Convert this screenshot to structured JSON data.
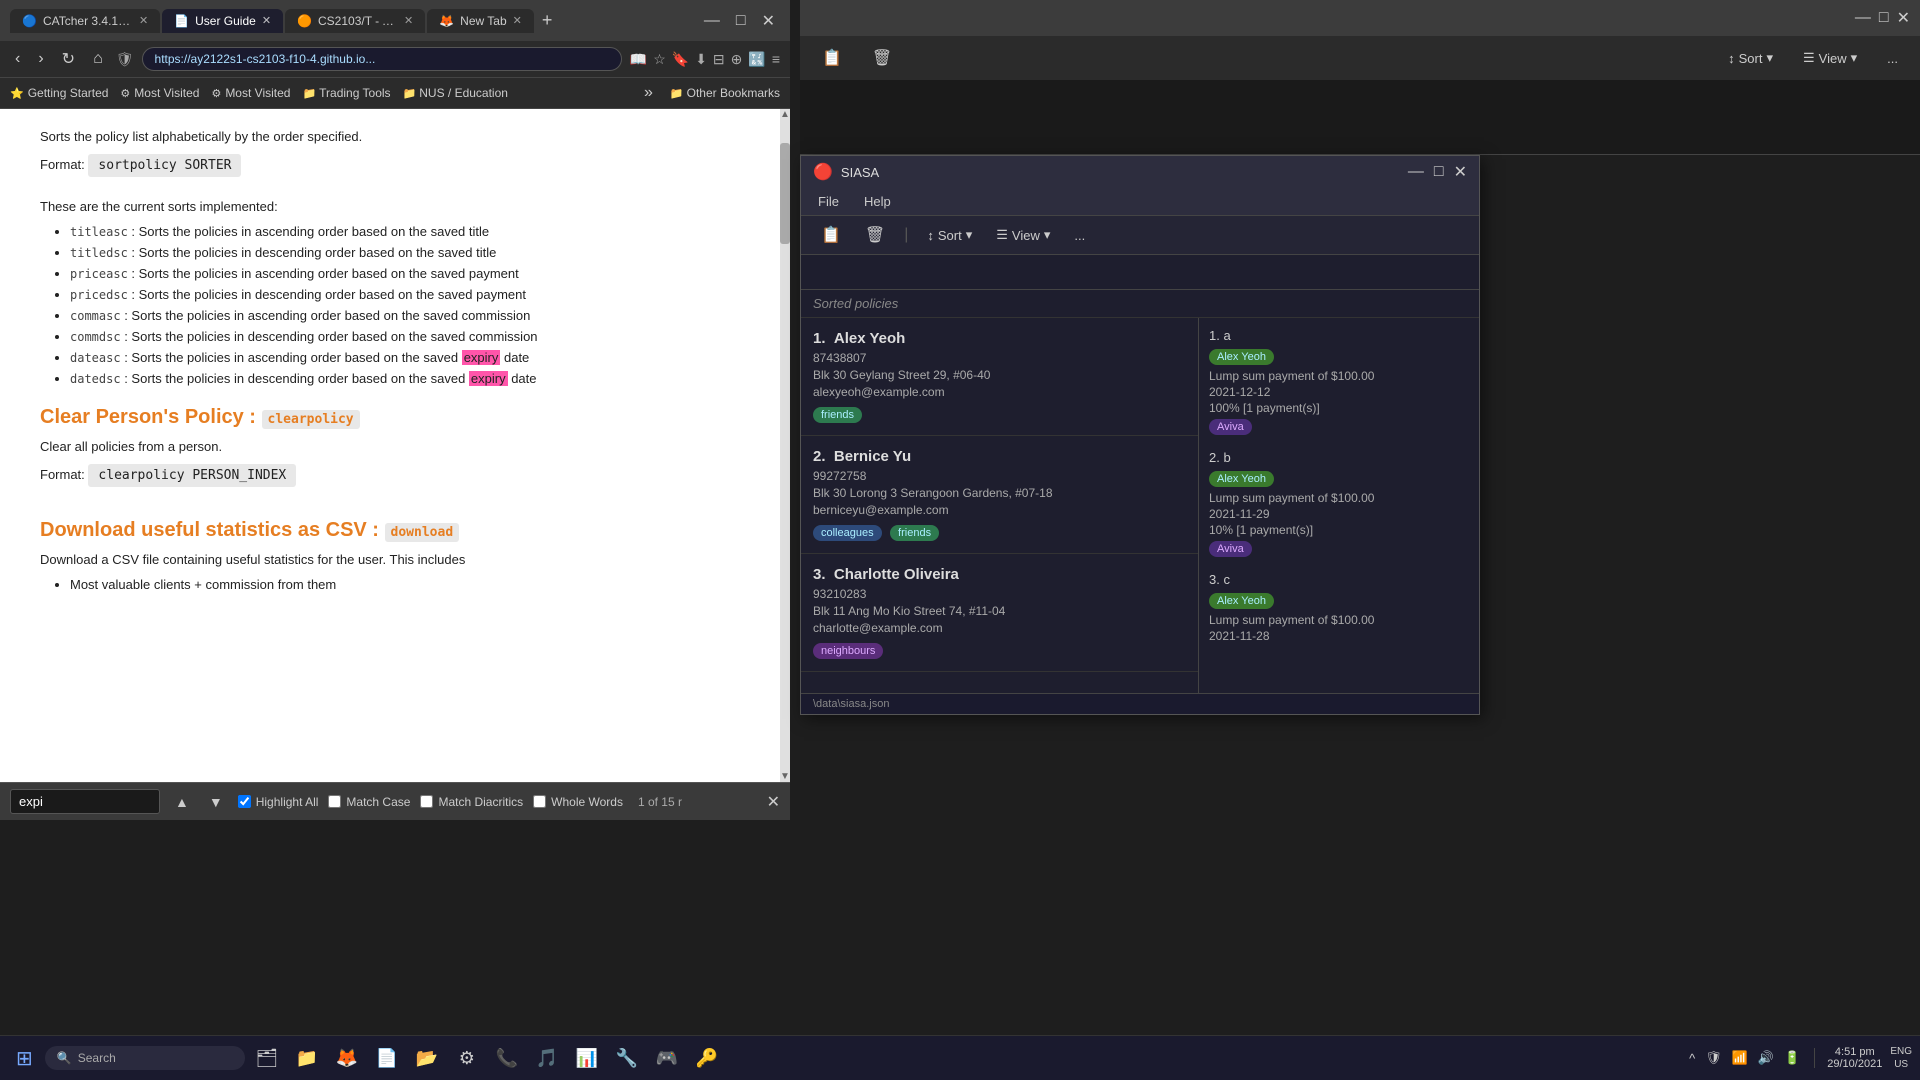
{
  "browser": {
    "tabs": [
      {
        "id": "tab1",
        "label": "CATcher 3.4.1 - ...",
        "icon": "🔵",
        "active": false
      },
      {
        "id": "tab2",
        "label": "User Guide",
        "icon": "📄",
        "active": true
      },
      {
        "id": "tab3",
        "label": "CS2103/T - Adr...",
        "icon": "🟠",
        "active": false
      },
      {
        "id": "tab4",
        "label": "New Tab",
        "icon": "🦊",
        "active": false
      }
    ],
    "address": "https://ay2122s1-cs2103-f10-4.github.io...",
    "bookmarks": [
      {
        "label": "Getting Started",
        "icon": "⭐"
      },
      {
        "label": "Most Visited",
        "icon": "⚙"
      },
      {
        "label": "Most Visited",
        "icon": "⚙"
      },
      {
        "label": "Trading Tools",
        "icon": "📁"
      },
      {
        "label": "NUS / Education",
        "icon": "📁"
      }
    ],
    "other_bookmarks": "Other Bookmarks"
  },
  "page": {
    "format_label": "Format:",
    "format_code1": "sortpolicy SORTER",
    "current_sorts_text": "These are the current sorts implemented:",
    "sorts": [
      {
        "code": "titleasc",
        "desc": ": Sorts the policies in ascending order based on the saved title"
      },
      {
        "code": "titledsc",
        "desc": ": Sorts the policies in descending order based on the saved title"
      },
      {
        "code": "priceasc",
        "desc": ": Sorts the policies in ascending order based on the saved payment"
      },
      {
        "code": "pricedsc",
        "desc": ": Sorts the policies in descending order based on the saved payment"
      },
      {
        "code": "commasc",
        "desc": ": Sorts the policies in ascending order based on the saved commission"
      },
      {
        "code": "commdsc",
        "desc": ": Sorts the policies in descending order based on the saved commission"
      },
      {
        "code": "dateasc",
        "desc": ": Sorts the policies in ascending order based on the saved expiry date"
      },
      {
        "code": "datedsc",
        "desc": ": Sorts the policies in descending order based on the saved expiry date"
      }
    ],
    "section2_title": "Clear Person's Policy :",
    "section2_cmd": "clearpolicy",
    "section2_desc": "Clear all policies from a person.",
    "section2_format": "Format:",
    "section2_code": "clearpolicy PERSON_INDEX",
    "section3_title": "Download useful statistics as CSV :",
    "section3_cmd": "download",
    "section3_desc": "Download a CSV file containing useful statistics for the user. This includes",
    "section3_bullet": "Most valuable clients + commission from them"
  },
  "find_bar": {
    "placeholder": "expi",
    "value": "expi",
    "prev_label": "▲",
    "next_label": "▼",
    "highlight_label": "Highlight All",
    "match_case_label": "Match Case",
    "match_diacritics_label": "Match Diacritics",
    "whole_words_label": "Whole Words",
    "count_text": "1 of 15 r",
    "close_label": "✕",
    "highlight_checked": true,
    "match_case_checked": false,
    "match_diacritics_checked": false,
    "whole_words_checked": false
  },
  "bg_window": {
    "title": "",
    "sort_btn": "Sort",
    "view_btn": "View",
    "more_btn": "...",
    "icons": [
      "📋",
      "🗑"
    ]
  },
  "siasa": {
    "title": "SIASA",
    "icon": "🔴",
    "menu": [
      "File",
      "Help"
    ],
    "input_placeholder": "",
    "input_cursor": "|",
    "result_label": "Sorted policies",
    "sort_btn": "Sort",
    "view_btn": "View",
    "more_btn": "...",
    "persons": [
      {
        "index": "1.",
        "name": "Alex Yeoh",
        "number": "87438807",
        "address": "Blk 30 Geylang Street 29, #06-40",
        "email": "alexyeoh@example.com",
        "tags": [
          "friends"
        ]
      },
      {
        "index": "2.",
        "name": "Bernice Yu",
        "number": "99272758",
        "address": "Blk 30 Lorong 3 Serangoon Gardens, #07-18",
        "email": "berniceyu@example.com",
        "tags": [
          "colleagues",
          "friends"
        ]
      },
      {
        "index": "3.",
        "name": "Charlotte Oliveira",
        "number": "93210283",
        "address": "Blk 11 Ang Mo Kio Street 74, #11-04",
        "email": "charlotte@example.com",
        "tags": [
          "neighbours"
        ]
      }
    ],
    "policies": [
      {
        "index": "1.  a",
        "person": "Alex Yeoh",
        "detail1": "Lump sum payment of $100.00",
        "detail2": "2021-12-12",
        "detail3": "100% [1 payment(s)]",
        "company": "Aviva"
      },
      {
        "index": "2.  b",
        "person": "Alex Yeoh",
        "detail1": "Lump sum payment of $100.00",
        "detail2": "2021-11-29",
        "detail3": "10% [1 payment(s)]",
        "company": "Aviva"
      },
      {
        "index": "3.  c",
        "person": "Alex Yeoh",
        "detail1": "Lump sum payment of $100.00",
        "detail2": "2021-11-28",
        "detail3": "",
        "company": ""
      }
    ],
    "statusbar": "\\data\\siasa.json"
  },
  "taskbar": {
    "start_icon": "⊞",
    "search_placeholder": "Search",
    "icons": [
      "📁",
      "🦊",
      "📄",
      "🗂",
      "📁",
      "🔧",
      "📞",
      "🎵",
      "📊",
      "🎮",
      "🔑"
    ],
    "sys_icons": [
      "^",
      "🔊",
      "📶",
      "🔋"
    ],
    "time": "4:51 pm",
    "date": "29/10/2021",
    "lang": "ENG\nUS"
  }
}
